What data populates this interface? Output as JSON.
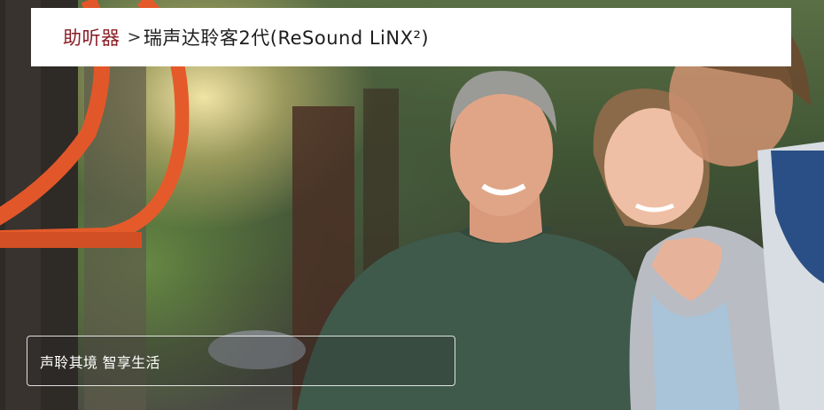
{
  "breadcrumb": {
    "root_label": "助听器",
    "separator": ">",
    "current_label": "瑞声达聆客2代(ReSound LiNX²)"
  },
  "hero": {
    "tagline": "声聆其境 智享生活"
  },
  "colors": {
    "breadcrumb_root": "#8a1c24",
    "breadcrumb_bg": "#ffffff",
    "tagline_text": "#ffffff"
  }
}
